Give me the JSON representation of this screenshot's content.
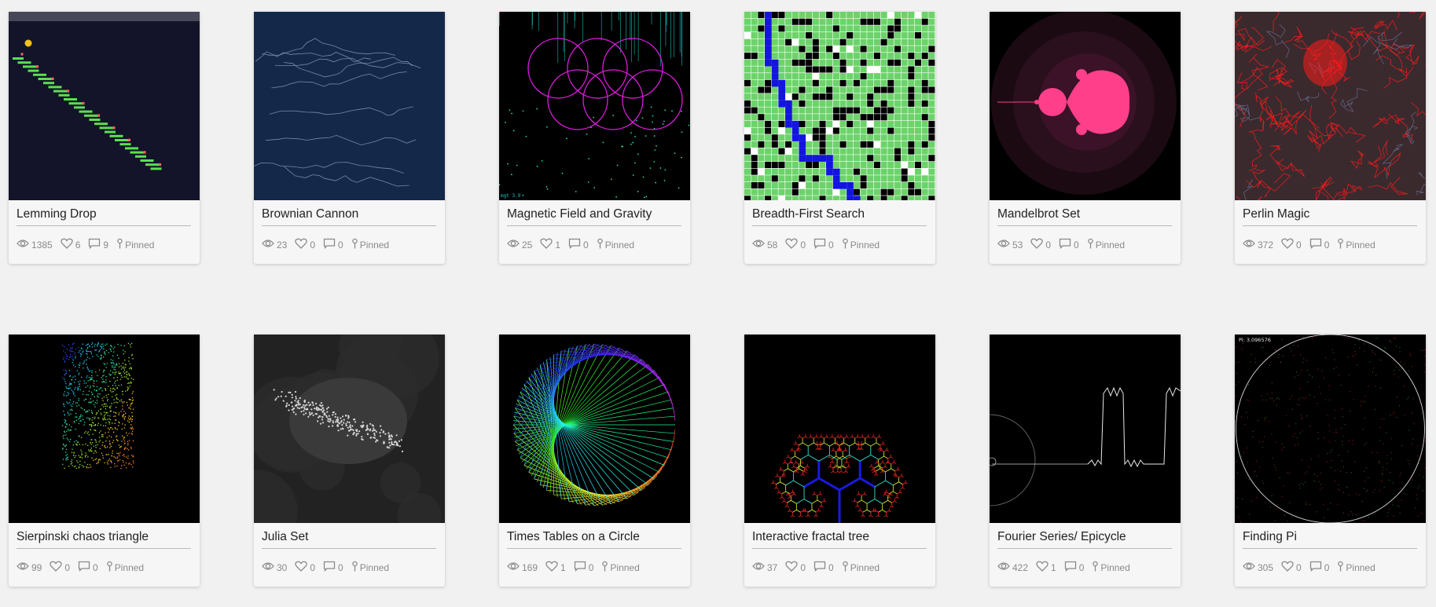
{
  "stats_labels": {
    "pinned": "Pinned"
  },
  "cards": [
    {
      "title": "Lemming Drop",
      "views": "1385",
      "likes": "6",
      "comments": "9",
      "thumb": "lemming-drop"
    },
    {
      "title": "Brownian Cannon",
      "views": "23",
      "likes": "0",
      "comments": "0",
      "thumb": "brownian-cannon"
    },
    {
      "title": "Magnetic Field and Gravity",
      "views": "25",
      "likes": "1",
      "comments": "0",
      "thumb": "magnetic-field"
    },
    {
      "title": "Breadth-First Search",
      "views": "58",
      "likes": "0",
      "comments": "0",
      "thumb": "breadth-first-search"
    },
    {
      "title": "Mandelbrot Set",
      "views": "53",
      "likes": "0",
      "comments": "0",
      "thumb": "mandelbrot-set"
    },
    {
      "title": "Perlin Magic",
      "views": "372",
      "likes": "0",
      "comments": "0",
      "thumb": "perlin-magic"
    },
    {
      "title": "Sierpinski chaos triangle",
      "views": "99",
      "likes": "0",
      "comments": "0",
      "thumb": "sierpinski"
    },
    {
      "title": "Julia Set",
      "views": "30",
      "likes": "0",
      "comments": "0",
      "thumb": "julia-set"
    },
    {
      "title": "Times Tables on a Circle",
      "views": "169",
      "likes": "1",
      "comments": "0",
      "thumb": "times-tables"
    },
    {
      "title": "Interactive fractal tree",
      "views": "37",
      "likes": "0",
      "comments": "0",
      "thumb": "fractal-tree"
    },
    {
      "title": "Fourier Series/ Epicycle",
      "views": "422",
      "likes": "1",
      "comments": "0",
      "thumb": "fourier-series"
    },
    {
      "title": "Finding Pi",
      "views": "305",
      "likes": "0",
      "comments": "0",
      "thumb": "finding-pi",
      "overlay_text": "Pi: 3.096576"
    }
  ],
  "thumb_texts": {
    "magnetic_label": "mgt 3.9"
  },
  "colors": {
    "page_bg": "#f1f1f1",
    "card_bg": "#f6f6f6",
    "lemming_bg": "#13132a",
    "brownian_bg": "#14284a",
    "bfs_green": "#6cd36a",
    "mandelbrot_pink": "#ff3f8a",
    "perlin_red": "#ff1a1a",
    "magenta": "#e11be1"
  }
}
